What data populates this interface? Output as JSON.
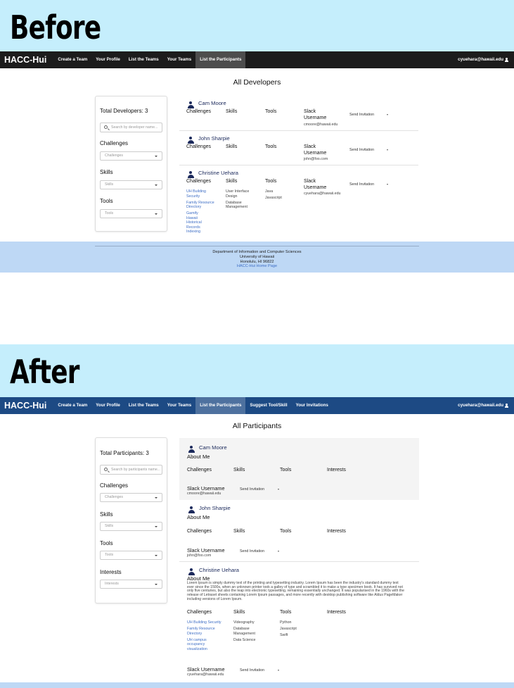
{
  "before": {
    "label": "Before",
    "nav": {
      "brand": "HACC-Hui",
      "items": [
        "Create a Team",
        "Your Profile",
        "List the Teams",
        "Your Teams",
        "List the Participants"
      ],
      "user": "cyuehara@hawaii.edu"
    },
    "title": "All Developers",
    "sidebar": {
      "count": "Total Developers: 3",
      "search_placeholder": "Search by developer name...",
      "challenges_label": "Challenges",
      "challenges_placeholder": "Challenges",
      "skills_label": "Skills",
      "skills_placeholder": "Skills",
      "tools_label": "Tools",
      "tools_placeholder": "Tools"
    },
    "headers": {
      "challenges": "Challenges",
      "skills": "Skills",
      "tools": "Tools",
      "slack": "Slack Username"
    },
    "invite_label": "Send Invitation",
    "developers": [
      {
        "name": "Cam Moore",
        "email": "cmoore@hawaii.edu",
        "challenges": [],
        "skills": [],
        "tools": []
      },
      {
        "name": "John Sharpie",
        "email": "john@foo.com",
        "challenges": [],
        "skills": [],
        "tools": []
      },
      {
        "name": "Christine Uehara",
        "email": "cyuehara@hawaii.edu",
        "challenges": [
          "UH Building Security",
          "Family Resource Directory",
          "Gamify Hawaii Historical Records Indexing"
        ],
        "skills": [
          "User Interface Design",
          "Database Management"
        ],
        "tools": [
          "Java",
          "Javascript"
        ]
      }
    ],
    "footer": {
      "line1": "Department of Information and Computer Sciences",
      "line2": "University of Hawaii",
      "line3": "Honolulu, HI 96822",
      "link": "HACC-Hui Home Page"
    }
  },
  "after": {
    "label": "After",
    "nav": {
      "brand": "HACC-Hui",
      "items": [
        "Create a Team",
        "Your Profile",
        "List the Teams",
        "Your Teams",
        "List the Participants",
        "Suggest Tool/Skill",
        "Your Invitations"
      ],
      "user": "cyuehara@hawaii.edu"
    },
    "title": "All Participants",
    "sidebar": {
      "count": "Total Participants: 3",
      "search_placeholder": "Search by participants name...",
      "challenges_label": "Challenges",
      "challenges_placeholder": "Challenges",
      "skills_label": "Skills",
      "skills_placeholder": "Skills",
      "tools_label": "Tools",
      "tools_placeholder": "Tools",
      "interests_label": "Interests",
      "interests_placeholder": "Interests"
    },
    "headers": {
      "about": "About Me",
      "challenges": "Challenges",
      "skills": "Skills",
      "tools": "Tools",
      "interests": "Interests",
      "slack": "Slack Username"
    },
    "invite_label": "Send Invitation",
    "participants": [
      {
        "name": "Cam Moore",
        "email": "cmoore@hawaii.edu",
        "about": "",
        "challenges": [],
        "skills": [],
        "tools": []
      },
      {
        "name": "John Sharpie",
        "email": "john@foo.com",
        "about": "",
        "challenges": [],
        "skills": [],
        "tools": []
      },
      {
        "name": "Christine Uehara",
        "email": "cyuehara@hawaii.edu",
        "about": "Lorem Ipsum is simply dummy text of the printing and typesetting industry. Lorem Ipsum has been the industry's standard dummy text ever since the 1500s, when an unknown printer took a galley of type and scrambled it to make a type specimen book. It has survived not only five centuries, but also the leap into electronic typesetting, remaining essentially unchanged. It was popularised in the 1960s with the release of Letraset sheets containing Lorem Ipsum passages, and more recently with desktop publishing software like Aldus PageMaker including versions of Lorem Ipsum.",
        "challenges": [
          "UH Building Security",
          "Family Resource Directory",
          "UH campus occupancy visualization"
        ],
        "skills": [
          "Videography",
          "Database Management",
          "Data Science"
        ],
        "tools": [
          "Python",
          "Javascript",
          "Swift"
        ]
      }
    ]
  }
}
